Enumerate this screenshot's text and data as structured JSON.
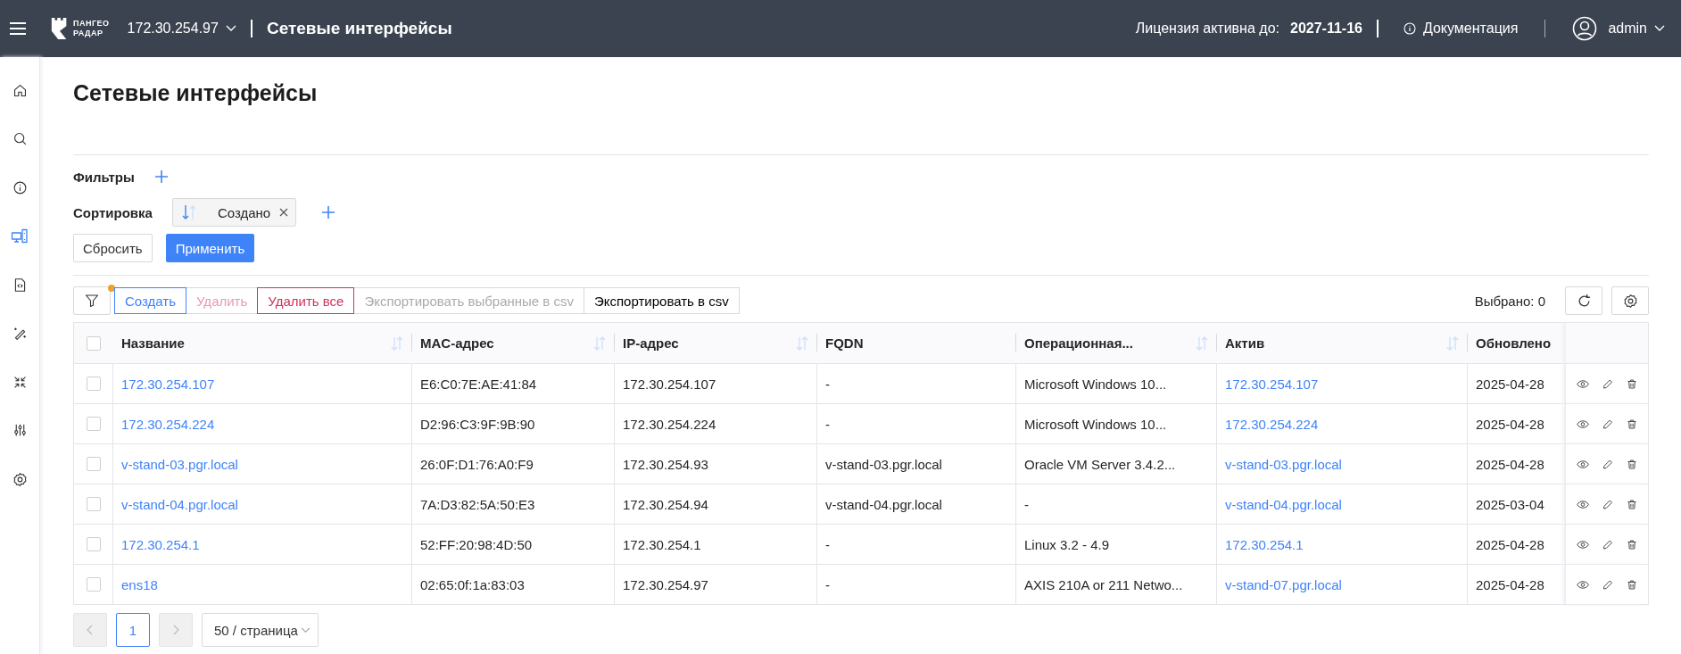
{
  "header": {
    "logo": [
      "ПАНГЕО",
      "РАДАР"
    ],
    "host": "172.30.254.97",
    "title": "Сетевые интерфейсы",
    "license_label": "Лицензия активна до:",
    "license_date": "2027-11-16",
    "docs": "Документация",
    "user": "admin"
  },
  "sidebar": {
    "items": [
      {
        "selected": false
      },
      {
        "selected": false
      },
      {
        "selected": false
      },
      {
        "selected": true
      },
      {
        "selected": false
      },
      {
        "selected": false
      },
      {
        "selected": false
      },
      {
        "selected": false
      },
      {
        "selected": false
      }
    ]
  },
  "page_title": "Сетевые интерфейсы",
  "filters": {
    "label": "Фильтры"
  },
  "sorting": {
    "label": "Сортировка",
    "chips": [
      {
        "label": "Создано",
        "descending": true
      }
    ]
  },
  "filter_buttons": [
    {
      "label": "Сбросить",
      "kind": "default"
    },
    {
      "label": "Применить",
      "kind": "primary"
    }
  ],
  "toolbar": {
    "filter_indicator": true,
    "buttons": [
      {
        "label": "Создать",
        "kind": "primary-outline",
        "disabled": false
      },
      {
        "label": "Удалить",
        "kind": "danger",
        "disabled": true
      },
      {
        "label": "Удалить все",
        "kind": "danger",
        "disabled": false
      },
      {
        "label": "Экспортировать выбранные в csv",
        "kind": "default",
        "disabled": true
      },
      {
        "label": "Экспортировать в csv",
        "kind": "default",
        "disabled": false
      }
    ],
    "selected_count": "Выбрано: 0"
  },
  "table": {
    "all_checked": false,
    "columns": [
      {
        "label": "Название",
        "kind": "link",
        "sortable": true
      },
      {
        "label": "MAC-адрес",
        "kind": "text",
        "sortable": true
      },
      {
        "label": "IP-адрес",
        "kind": "text",
        "sortable": true
      },
      {
        "label": "FQDN",
        "kind": "text",
        "sortable": false
      },
      {
        "label": "Операционная...",
        "kind": "text",
        "sortable": true
      },
      {
        "label": "Актив",
        "kind": "link",
        "sortable": true
      },
      {
        "label": "Обновлено",
        "kind": "text",
        "sortable": false
      }
    ],
    "rows": [
      {
        "checked": false,
        "cells": [
          "172.30.254.107",
          "E6:C0:7E:AE:41:84",
          "172.30.254.107",
          "-",
          "Microsoft Windows 10...",
          "172.30.254.107",
          "2025-04-28"
        ]
      },
      {
        "checked": false,
        "cells": [
          "172.30.254.224",
          "D2:96:C3:9F:9B:90",
          "172.30.254.224",
          "-",
          "Microsoft Windows 10...",
          "172.30.254.224",
          "2025-04-28"
        ]
      },
      {
        "checked": false,
        "cells": [
          "v-stand-03.pgr.local",
          "26:0F:D1:76:A0:F9",
          "172.30.254.93",
          "v-stand-03.pgr.local",
          "Oracle VM Server 3.4.2...",
          "v-stand-03.pgr.local",
          "2025-04-28"
        ]
      },
      {
        "checked": false,
        "cells": [
          "v-stand-04.pgr.local",
          "7A:D3:82:5A:50:E3",
          "172.30.254.94",
          "v-stand-04.pgr.local",
          "-",
          "v-stand-04.pgr.local",
          "2025-03-04"
        ]
      },
      {
        "checked": false,
        "cells": [
          "172.30.254.1",
          "52:FF:20:98:4D:50",
          "172.30.254.1",
          "-",
          "Linux 3.2 - 4.9",
          "172.30.254.1",
          "2025-04-28"
        ]
      },
      {
        "checked": false,
        "cells": [
          "ens18",
          "02:65:0f:1a:83:03",
          "172.30.254.97",
          "-",
          "AXIS 210A or 211 Netwo...",
          "v-stand-07.pgr.local",
          "2025-04-28"
        ]
      }
    ]
  },
  "pagination": {
    "prev_disabled": true,
    "next_disabled": true,
    "pages": [
      {
        "label": "1",
        "selected": true
      }
    ],
    "page_size": "50 / страница"
  }
}
